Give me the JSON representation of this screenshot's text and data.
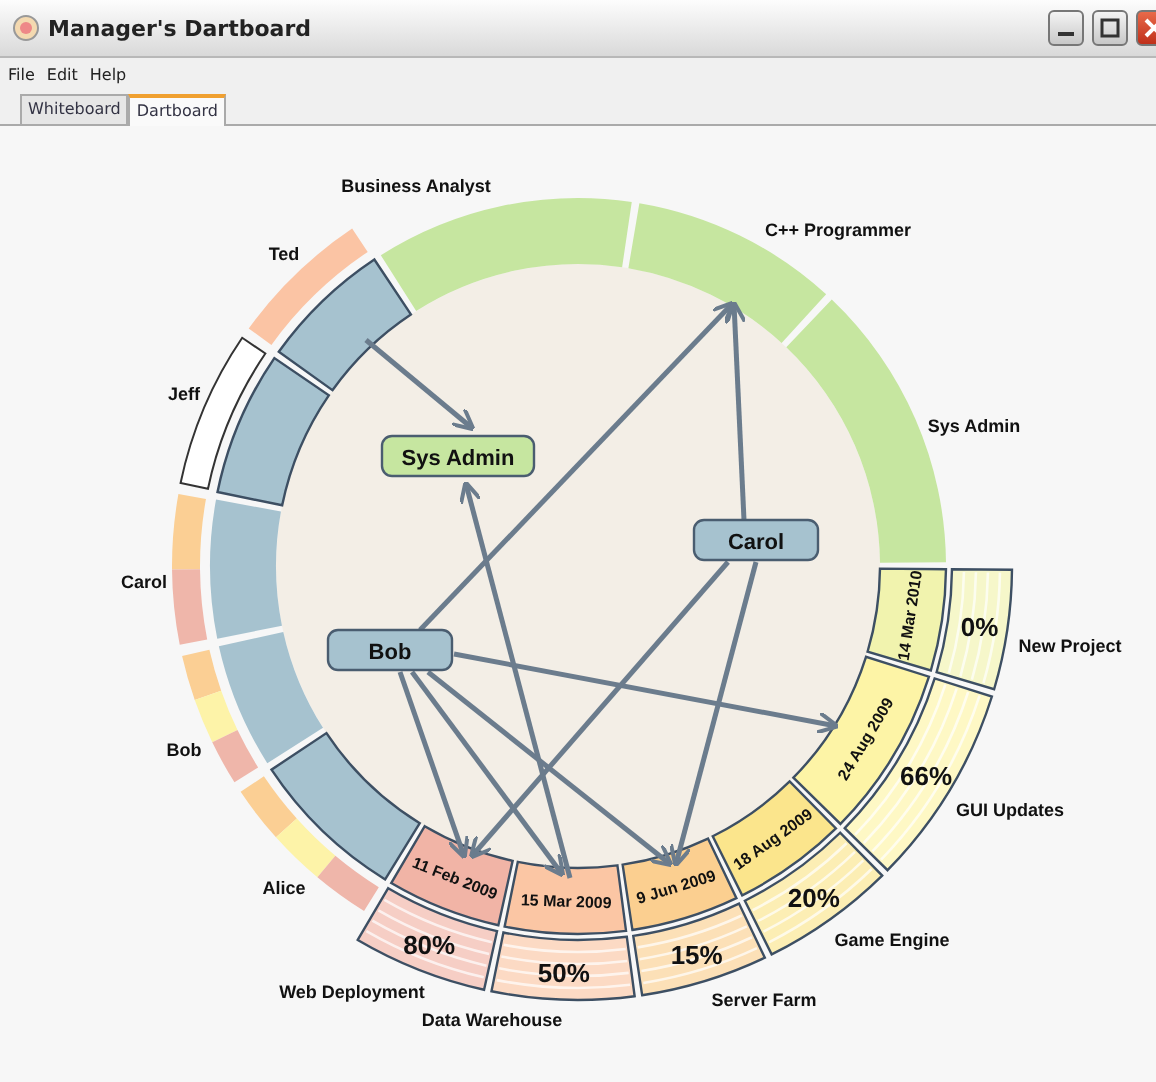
{
  "window": {
    "title": "Manager's Dartboard"
  },
  "menu": [
    "File",
    "Edit",
    "Help"
  ],
  "tabs": [
    {
      "label": "Whiteboard",
      "selected": false
    },
    {
      "label": "Dartboard",
      "selected": true
    }
  ],
  "dartboard": {
    "roles": [
      {
        "name": "Business Analyst"
      },
      {
        "name": "C++ Programmer"
      },
      {
        "name": "Sys Admin"
      }
    ],
    "people": [
      {
        "name": "Ted",
        "highlighted": true,
        "bands": [
          {
            "color": "#fbc4a4"
          }
        ]
      },
      {
        "name": "Jeff",
        "highlighted": true
      },
      {
        "name": "Carol",
        "highlighted": false,
        "bands": [
          {
            "color": "#fbcf94"
          },
          {
            "color": "#efb6aa"
          }
        ]
      },
      {
        "name": "Bob",
        "highlighted": false,
        "bands": [
          {
            "color": "#fbcf94"
          },
          {
            "color": "#fdf3a8"
          },
          {
            "color": "#efb6aa"
          }
        ]
      },
      {
        "name": "Alice",
        "highlighted": true,
        "bands": [
          {
            "color": "#fbcf94"
          },
          {
            "color": "#fdf3a8"
          },
          {
            "color": "#efb6aa"
          }
        ]
      }
    ],
    "tasks": [
      {
        "date": "11 Feb 2009",
        "color": "#f1b4a6",
        "project": "Web Deployment",
        "progress": "80%"
      },
      {
        "date": "15 Mar 2009",
        "color": "#fbc6a4",
        "project": "Data Warehouse",
        "progress": "50%"
      },
      {
        "date": "9 Jun 2009",
        "color": "#fbcf90",
        "project": "Server Farm",
        "progress": "15%"
      },
      {
        "date": "18 Aug 2009",
        "color": "#fbe58c",
        "project": "Game Engine",
        "progress": "20%"
      },
      {
        "date": "24 Aug 2009",
        "color": "#fdf4a6",
        "project": "GUI Updates",
        "progress": "66%"
      },
      {
        "date": "14 Mar 2010",
        "color": "#f1f3ae",
        "project": "New Project",
        "progress": "0%"
      }
    ],
    "nodes": [
      {
        "label": "Sys Admin",
        "kind": "role"
      },
      {
        "label": "Carol",
        "kind": "person"
      },
      {
        "label": "Bob",
        "kind": "person"
      }
    ]
  }
}
